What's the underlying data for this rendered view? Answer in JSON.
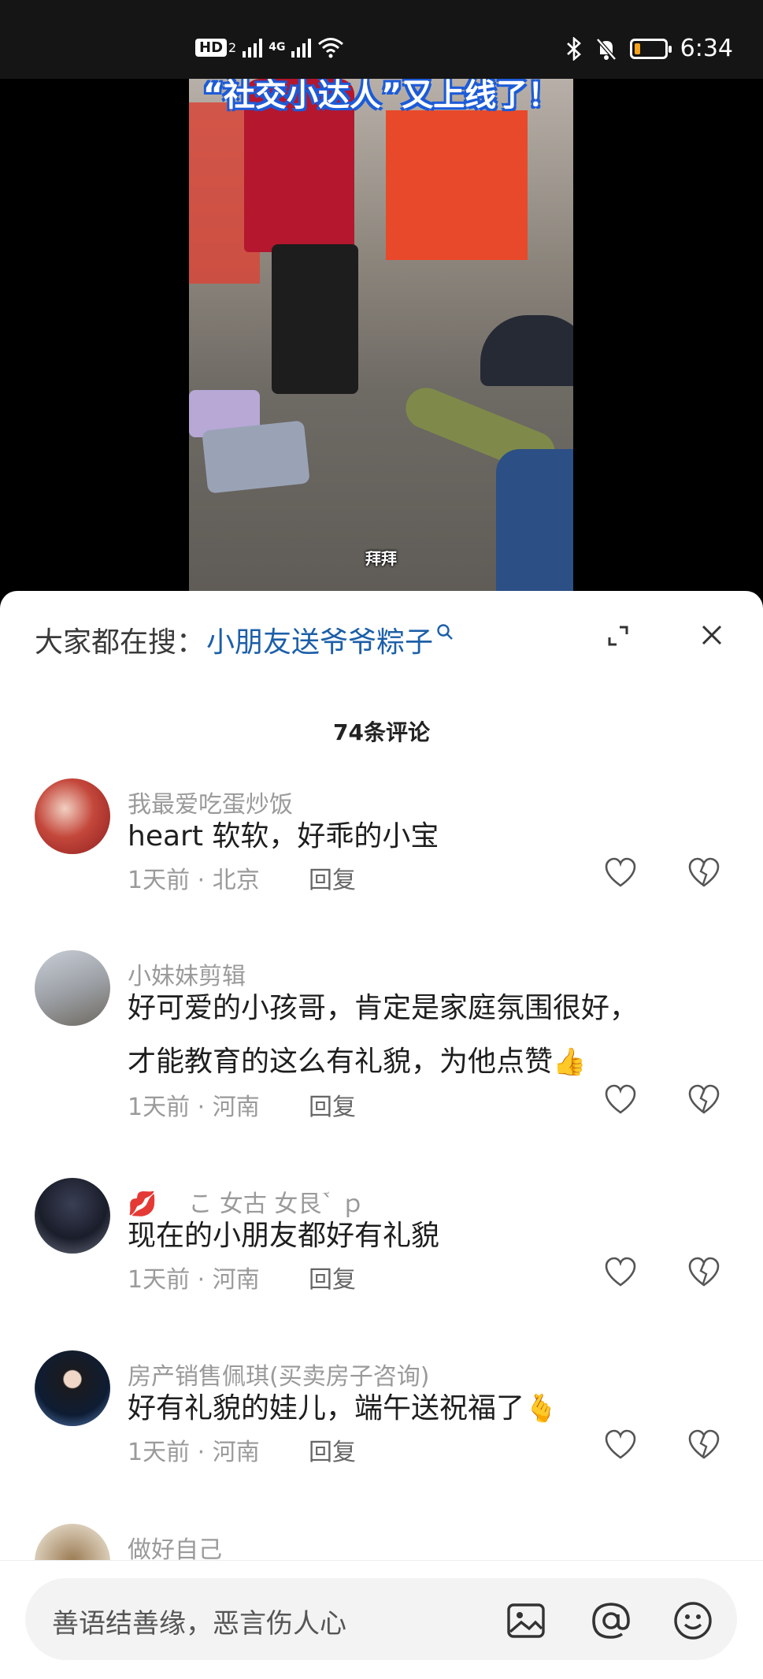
{
  "status_bar": {
    "hd_label": "HD",
    "hd_sub": "2",
    "network_label": "4G",
    "time": "6:34",
    "battery_level": 0.2,
    "battery_color": "#f7a21b"
  },
  "video": {
    "title_overlay": "“社交小达人”又上线了！",
    "subtitle": "拜拜"
  },
  "sheet": {
    "hot_search_prefix": "大家都在搜：",
    "hot_search_term": "小朋友送爷爷粽子",
    "search_icon": "search-icon",
    "expand_icon": "expand-icon",
    "close_icon": "close-icon",
    "comment_count": "74条评论"
  },
  "comments": [
    {
      "username": "我最爱吃蛋炒饭",
      "text": "heart 软软，好乖的小宝",
      "meta": "1天前 · 北京",
      "reply": "回复"
    },
    {
      "username": "小妹妹剪辑",
      "text_line1": "好可爱的小孩哥，肯定是家庭氛围很好，",
      "text_line2": "才能教育的这么有礼貌，为他点赞",
      "emoji": "👍",
      "meta": "1天前 · 河南",
      "reply": "回复"
    },
    {
      "username_emoji": "💋",
      "username": "こ 女古 女艮ؔ` ｐ",
      "text": "现在的小朋友都好有礼貌",
      "meta": "1天前 · 河南",
      "reply": "回复"
    },
    {
      "username": "房产销售佩琪(买卖房子咨询)",
      "text": "好有礼貌的娃儿，端午送祝福了",
      "emoji": "🫰",
      "meta": "1天前 · 河南",
      "reply": "回复"
    },
    {
      "username": "做好自己"
    }
  ],
  "input_bar": {
    "placeholder": "善语结善缘，恶言伤人心",
    "icons": [
      "image-icon",
      "at-icon",
      "emoji-icon"
    ]
  }
}
